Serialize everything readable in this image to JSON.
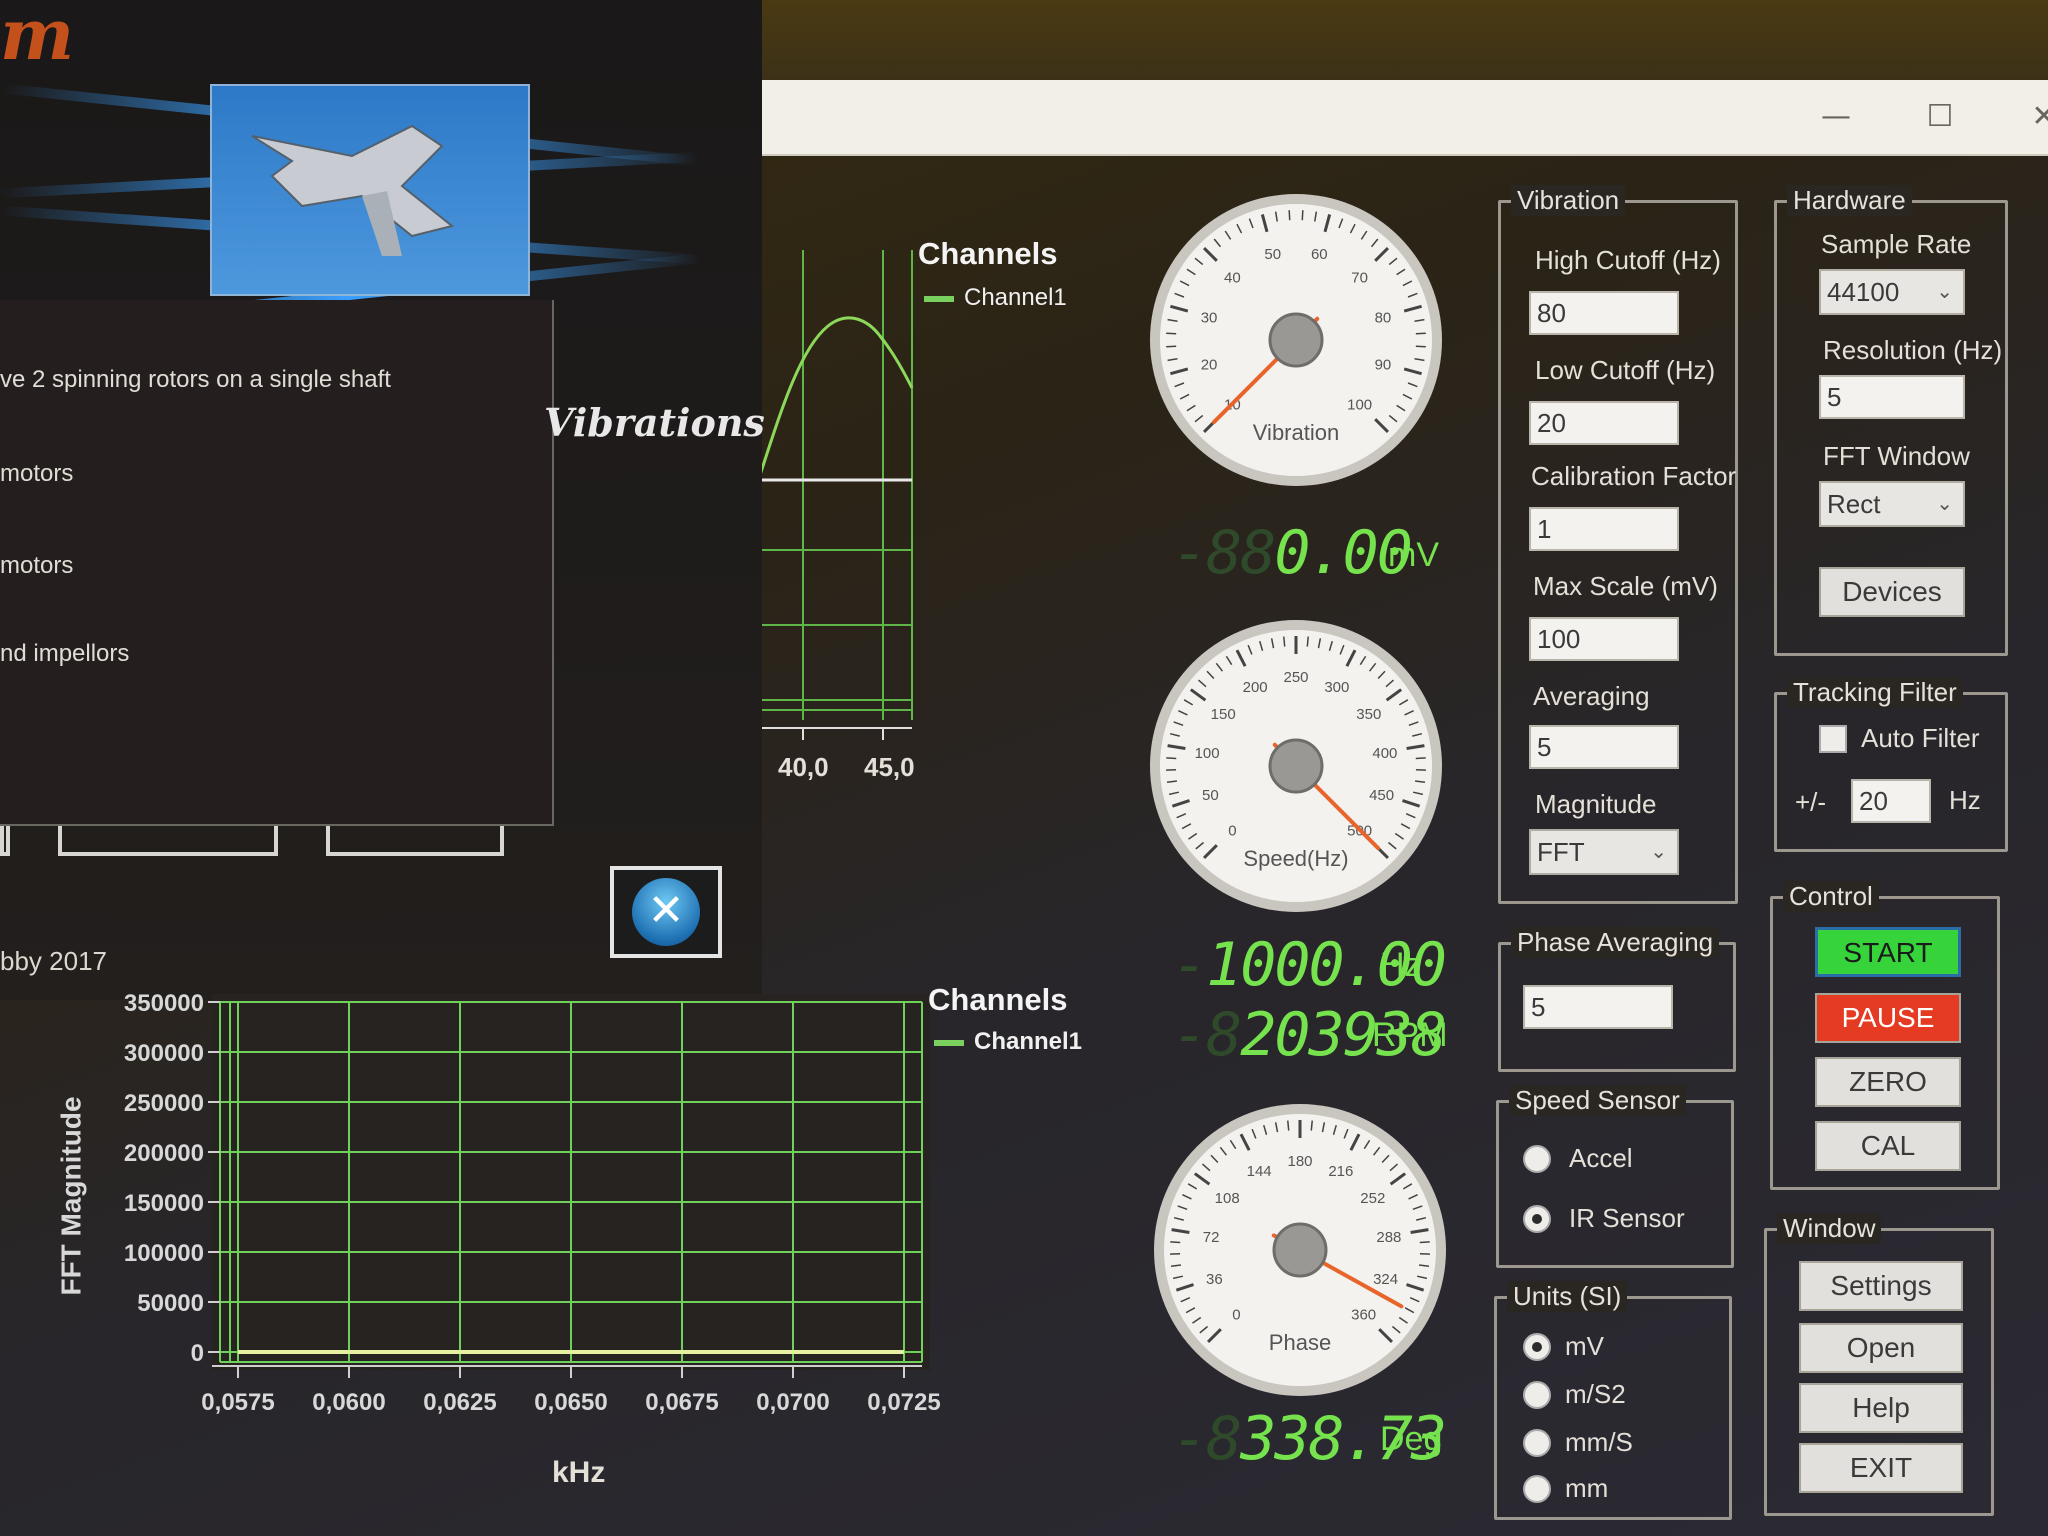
{
  "window": {
    "minimize_icon": "minimize-icon",
    "maximize_icon": "maximize-icon",
    "close_icon": "close-icon",
    "minimize_glyph": "—",
    "maximize_glyph": "☐",
    "close_glyph": "✕"
  },
  "splash": {
    "logo_fragment": "m",
    "tagline": "Vibrations",
    "lines": [
      "ve 2 spinning rotors on a single shaft",
      "motors",
      "motors",
      "nd impellors"
    ],
    "copyright": "bby 2017",
    "close_glyph": "✕"
  },
  "top_chart": {
    "legend_title": "Channels",
    "legend_item": "Channel1",
    "tick_labels": [
      "40,0",
      "45,0"
    ]
  },
  "fft_chart": {
    "legend_title": "Channels",
    "legend_item": "Channel1",
    "xlabel": "kHz",
    "ylabel": "FFT Magnitude",
    "y_ticks": [
      "350000",
      "300000",
      "250000",
      "200000",
      "150000",
      "100000",
      "50000",
      "0"
    ],
    "x_ticks": [
      "0,0575",
      "0,0600",
      "0,0625",
      "0,0650",
      "0,0675",
      "0,0700",
      "0,0725"
    ]
  },
  "chart_data": {
    "type": "line",
    "title": "",
    "xlabel": "kHz",
    "ylabel": "FFT Magnitude",
    "xlim": [
      0.0575,
      0.0725
    ],
    "ylim": [
      0,
      350000
    ],
    "grid": true,
    "legend_placement": "right",
    "series": [
      {
        "name": "Channel1",
        "x": [
          0.0575,
          0.0725
        ],
        "y": [
          0,
          0
        ]
      }
    ]
  },
  "gauges": {
    "vibration": {
      "label": "Vibration",
      "ticks": [
        "10",
        "20",
        "30",
        "40",
        "50",
        "60",
        "70",
        "80",
        "90",
        "100"
      ],
      "value": 0.0,
      "readout_ghost": "-88",
      "readout": "0.00",
      "unit": "mV"
    },
    "speed": {
      "label": "Speed(Hz)",
      "ticks": [
        "0",
        "50",
        "100",
        "150",
        "200",
        "250",
        "300",
        "350",
        "400",
        "450",
        "500"
      ],
      "value": 1000.0,
      "readout_ghost": "-",
      "readout": "1000.00",
      "unit": "Hz",
      "rpm_ghost": "-8",
      "rpm": "203938",
      "rpm_unit": "RPM"
    },
    "phase": {
      "label": "Phase",
      "ticks": [
        "0",
        "36",
        "72",
        "108",
        "144",
        "180",
        "216",
        "252",
        "288",
        "324",
        "360"
      ],
      "value": 338.73,
      "readout_ghost": "-8",
      "readout": "338.73",
      "unit": "Deg"
    }
  },
  "vibration_group": {
    "title": "Vibration",
    "high_cutoff_label": "High Cutoff (Hz)",
    "high_cutoff": "80",
    "low_cutoff_label": "Low Cutoff (Hz)",
    "low_cutoff": "20",
    "calibration_label": "Calibration Factor",
    "calibration": "1",
    "max_scale_label": "Max Scale (mV)",
    "max_scale": "100",
    "averaging_label": "Averaging",
    "averaging": "5",
    "magnitude_label": "Magnitude",
    "magnitude": "FFT"
  },
  "phase_group": {
    "title": "Phase Averaging",
    "value": "5"
  },
  "speed_sensor": {
    "title": "Speed Sensor",
    "options": [
      "Accel",
      "IR Sensor"
    ],
    "selected": "IR Sensor"
  },
  "units": {
    "title": "Units (SI)",
    "options": [
      "mV",
      "m/S2",
      "mm/S",
      "mm"
    ],
    "selected": "mV"
  },
  "hardware": {
    "title": "Hardware",
    "sample_rate_label": "Sample Rate",
    "sample_rate": "44100",
    "resolution_label": "Resolution (Hz)",
    "resolution": "5",
    "fft_window_label": "FFT Window",
    "fft_window": "Rect",
    "devices_button": "Devices"
  },
  "tracking": {
    "title": "Tracking Filter",
    "auto_filter_label": "Auto Filter",
    "auto_filter": false,
    "plusminus": "+/-",
    "value": "20",
    "unit": "Hz"
  },
  "control": {
    "title": "Control",
    "start": "START",
    "pause": "PAUSE",
    "zero": "ZERO",
    "cal": "CAL"
  },
  "window_group": {
    "title": "Window",
    "settings": "Settings",
    "open": "Open",
    "help": "Help",
    "exit": "EXIT"
  },
  "colors": {
    "accent_green": "#76e34e",
    "grid_green": "#6fd05a",
    "start": "#36d43a",
    "pause": "#e43b22",
    "needle": "#e8642a"
  }
}
